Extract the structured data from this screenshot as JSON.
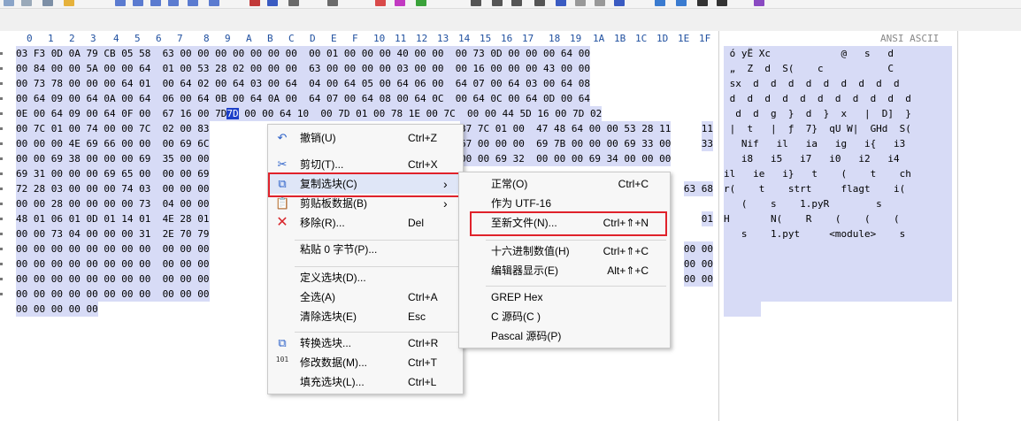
{
  "header": {
    "columns": [
      "0",
      "1",
      "2",
      "3",
      "4",
      "5",
      "6",
      "7",
      "8",
      "9",
      "A",
      "B",
      "C",
      "D",
      "E",
      "F",
      "10",
      "11",
      "12",
      "13",
      "14",
      "15",
      "16",
      "17",
      "18",
      "19",
      "1A",
      "1B",
      "1C",
      "1D",
      "1E",
      "1F"
    ],
    "ansi_label": "ANSI ASCII"
  },
  "hex_rows": [
    "03 F3 0D 0A 79 CB 05 58  63 00 00 00 00 00 00 00  00 01 00 00 00 40 00 00  00 73 0D 00 00 00 64 00",
    "00 84 00 00 5A 00 00 64  01 00 53 28 02 00 00 00  63 00 00 00 00 03 00 00  00 16 00 00 00 43 00 00",
    "00 73 78 00 00 00 64 01  00 64 02 00 64 03 00 64  04 00 64 05 00 64 06 00  64 07 00 64 03 00 64 08",
    "00 64 09 00 64 0A 00 64  06 00 64 0B 00 64 0A 00  64 07 00 64 08 00 64 0C  00 64 0C 00 64 0D 00 64",
    "0E 00 64 09 00 64 0F 00  67 16 00 7D",
    "00 7C 01 00 74 00 00 7C  02 00 83",
    "00 00 00 4E 69 66 00 00  00 69 6C",
    "00 00 69 38 00 00 00 69  35 00 00",
    "69 31 00 00 00 69 65 00  00 00 69",
    "72 28 03 00 00 00 74 03  00 00 00",
    "00 00 28 00 00 00 00 73  04 00 00",
    "48 01 06 01 0D 01 14 01  4E 28 01",
    "00 00 73 04 00 00 00 31  2E 70 79",
    "00 00 00 00 00 00 00 00  00 00 00",
    "00 00 00 00 00 00 00 00  00 00 00",
    "00 00 00 00 00 00 00 00  00 00 00",
    "00 00 00 00 00 00 00 00  00 00 00"
  ],
  "hex_row4_cursor": "7D",
  "hex_row4_rest": " 00 00 64 10  00 7D 01 00 78 1E 00 7C  00 00 44 5D 16 00 7D 02",
  "hex_right_rows": [
    "",
    "",
    "",
    "",
    "",
    "11",
    "33",
    "",
    "",
    "63 68",
    "",
    "01",
    "",
    "00 00",
    "00 00",
    "00 00",
    ""
  ],
  "hex_right2": {
    "r5": "37 7C 01 00  47 48 64 00 00 53 28 11",
    "r6": "67 00 00 00  69 7B 00 00 00 69 33 00",
    "r7": "00 00 69 32  00 00 00 69 34 00 00 00"
  },
  "hex_last_row": "00 00 00 00 00",
  "ascii_rows": [
    " ó yË Xc            @   s   d",
    " „  Z  d  S(    c           C",
    " sx  d  d  d  d  d  d  d  d  d",
    " d  d  d  d  d  d  d  d  d  d  d",
    "  d  d  g  }  d  }  x   |  D]  }",
    " |  t   |  ƒ  7}  qU W|  GHd  S(",
    "   Nif   il   ia   ig   i{   i3",
    "   i8   i5   i7   i0   i2   i4",
    "il   ie   i}   t    (    t    ch",
    "r(    t    strt     flagt    i(",
    "   (    s    1.pyR        s",
    "H       N(    R    (    (    (",
    "   s    1.pyt     <module>    s",
    "",
    "",
    "",
    ""
  ],
  "menu_main": {
    "items": [
      {
        "label": "撤销(U)",
        "shortcut": "Ctrl+Z",
        "icon": "undo-icon",
        "glyph": "↶"
      },
      {
        "label": "剪切(T)...",
        "shortcut": "Ctrl+X",
        "icon": "scissors-icon",
        "glyph": "✂"
      },
      {
        "label": "复制选块(C)",
        "shortcut": "",
        "icon": "copy-block-icon",
        "glyph": "⧉"
      },
      {
        "label": "剪贴板数据(B)",
        "shortcut": "",
        "icon": "clipboard-icon",
        "glyph": "📋"
      },
      {
        "label": "移除(R)...",
        "shortcut": "Del",
        "icon": "remove-icon",
        "glyph": "✕"
      },
      {
        "label": "粘贴 0 字节(P)...",
        "shortcut": "",
        "icon": "",
        "glyph": ""
      },
      {
        "label": "定义选块(D)...",
        "shortcut": "",
        "icon": "",
        "glyph": ""
      },
      {
        "label": "全选(A)",
        "shortcut": "Ctrl+A",
        "icon": "",
        "glyph": ""
      },
      {
        "label": "清除选块(E)",
        "shortcut": "Esc",
        "icon": "",
        "glyph": ""
      },
      {
        "label": "转换选块...",
        "shortcut": "Ctrl+R",
        "icon": "convert-icon",
        "glyph": "⧉"
      },
      {
        "label": "修改数据(M)...",
        "shortcut": "Ctrl+T",
        "icon": "binary-icon",
        "glyph": "101"
      },
      {
        "label": "填充选块(L)...",
        "shortcut": "Ctrl+L",
        "icon": "",
        "glyph": ""
      }
    ],
    "submenu_arrow": "›"
  },
  "menu_sub": {
    "items": [
      {
        "label": "正常(O)",
        "shortcut": "Ctrl+C"
      },
      {
        "label": "作为 UTF-16",
        "shortcut": ""
      },
      {
        "label": "至新文件(N)...",
        "shortcut": "Ctrl+⇑+N"
      },
      {
        "label": "十六进制数值(H)",
        "shortcut": "Ctrl+⇑+C"
      },
      {
        "label": "编辑器显示(E)",
        "shortcut": "Alt+⇑+C"
      },
      {
        "label": "GREP Hex",
        "shortcut": ""
      },
      {
        "label": "C 源码(C )",
        "shortcut": ""
      },
      {
        "label": "Pascal 源码(P)",
        "shortcut": ""
      }
    ]
  },
  "colors": {
    "selection": "#d7dbf6",
    "cursor": "#1c3fc9",
    "highlight_border": "#e0222b",
    "column_header": "#1f4f9f"
  }
}
